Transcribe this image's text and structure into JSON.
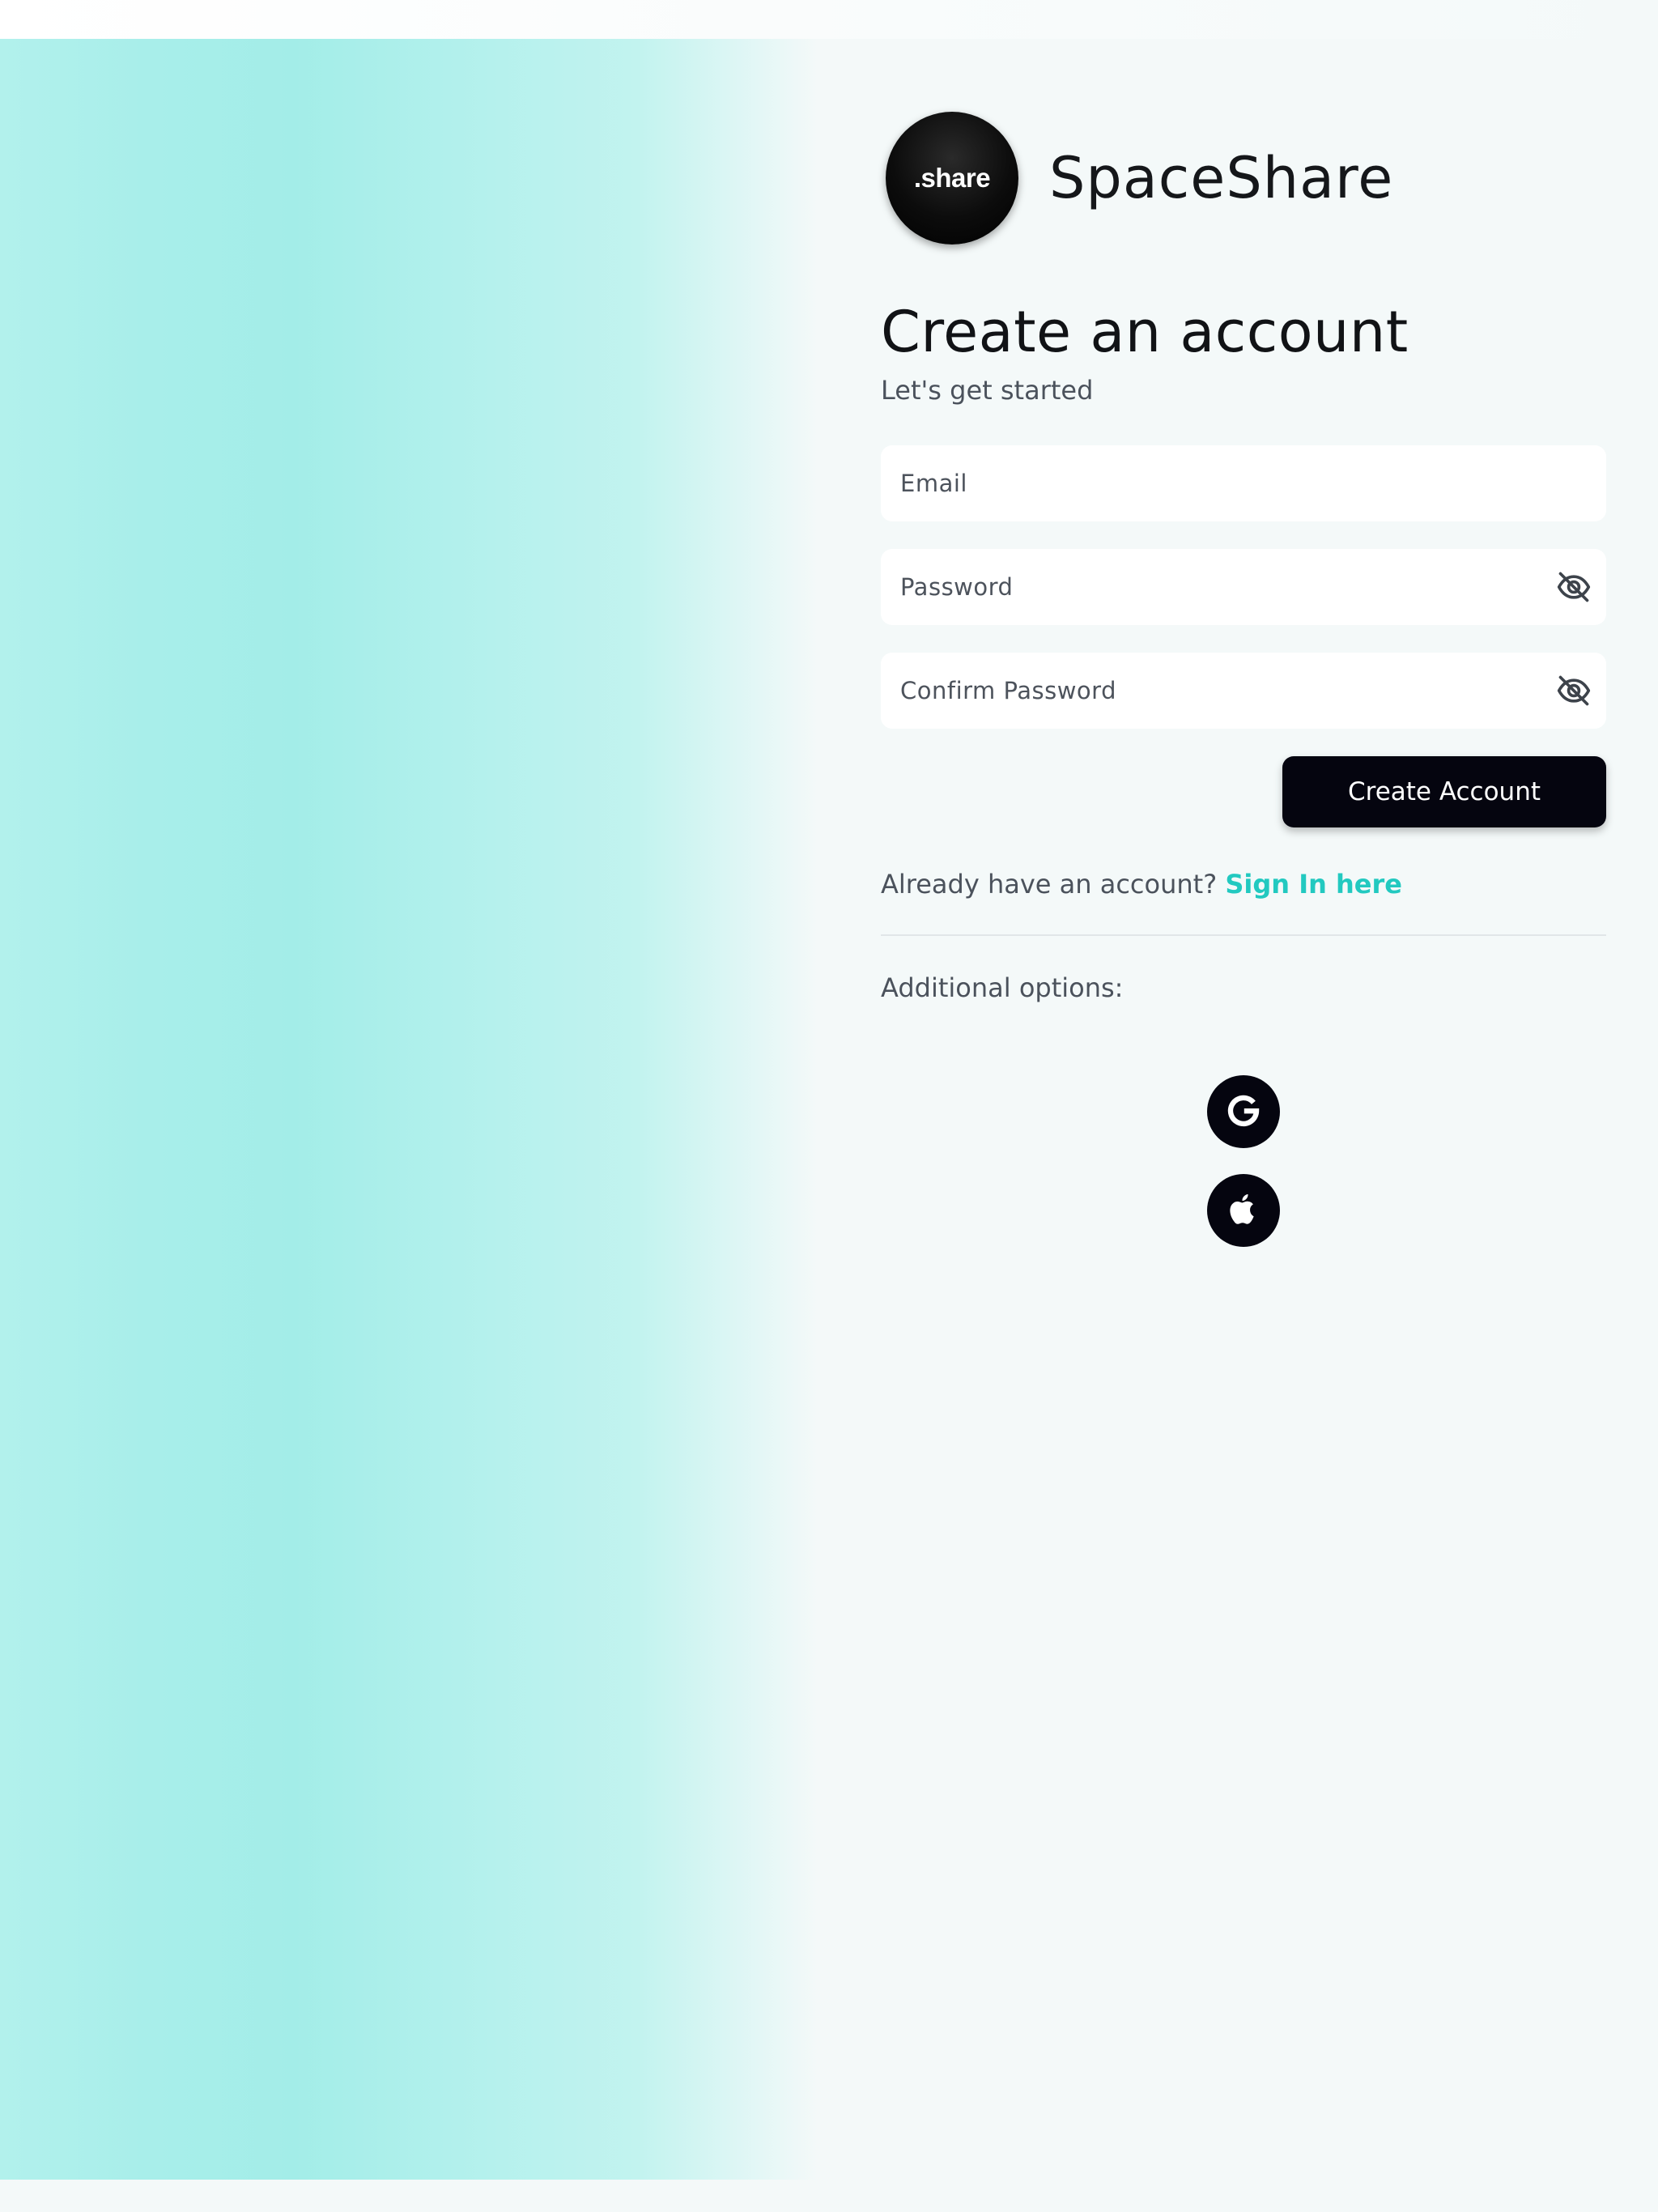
{
  "brand": {
    "logo_text": ".share",
    "name": "SpaceShare"
  },
  "header": {
    "title": "Create an account",
    "subtitle": "Let's get started"
  },
  "form": {
    "email_placeholder": "Email",
    "password_placeholder": "Password",
    "confirm_password_placeholder": "Confirm Password",
    "submit_label": "Create Account",
    "visibility_icon": "eye-off-icon"
  },
  "signin": {
    "prompt": "Already have an account?",
    "link_label": "Sign In here"
  },
  "options": {
    "label": "Additional options:",
    "providers": [
      "google-icon",
      "apple-icon"
    ]
  },
  "colors": {
    "accent": "#22c9c0",
    "button": "#05050f",
    "hero_gradient": "#a3ede8"
  }
}
